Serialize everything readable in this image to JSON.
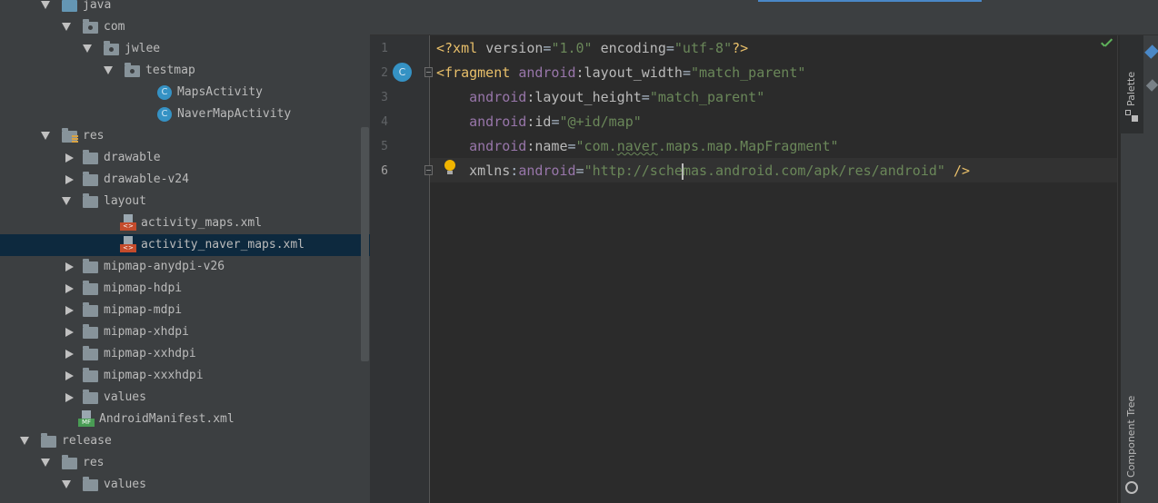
{
  "project_tree": {
    "items": [
      {
        "label": "java",
        "expanded": true,
        "icon": "folder-blue-icon"
      },
      {
        "label": "com",
        "expanded": true,
        "icon": "package-icon"
      },
      {
        "label": "jwlee",
        "expanded": true,
        "icon": "package-icon"
      },
      {
        "label": "testmap",
        "expanded": true,
        "icon": "package-icon"
      },
      {
        "label": "MapsActivity",
        "icon": "class-icon",
        "icon_text": "C"
      },
      {
        "label": "NaverMapActivity",
        "icon": "class-icon",
        "icon_text": "C"
      },
      {
        "label": "res",
        "expanded": true,
        "icon": "resource-folder-icon"
      },
      {
        "label": "drawable",
        "expanded": false,
        "icon": "folder-icon"
      },
      {
        "label": "drawable-v24",
        "expanded": false,
        "icon": "folder-icon"
      },
      {
        "label": "layout",
        "expanded": true,
        "icon": "folder-icon"
      },
      {
        "label": "activity_maps.xml",
        "icon": "xml-file-icon",
        "icon_text": "<>"
      },
      {
        "label": "activity_naver_maps.xml",
        "icon": "xml-file-icon",
        "icon_text": "<>",
        "selected": true
      },
      {
        "label": "mipmap-anydpi-v26",
        "expanded": false,
        "icon": "folder-icon"
      },
      {
        "label": "mipmap-hdpi",
        "expanded": false,
        "icon": "folder-icon"
      },
      {
        "label": "mipmap-mdpi",
        "expanded": false,
        "icon": "folder-icon"
      },
      {
        "label": "mipmap-xhdpi",
        "expanded": false,
        "icon": "folder-icon"
      },
      {
        "label": "mipmap-xxhdpi",
        "expanded": false,
        "icon": "folder-icon"
      },
      {
        "label": "mipmap-xxxhdpi",
        "expanded": false,
        "icon": "folder-icon"
      },
      {
        "label": "values",
        "expanded": false,
        "icon": "folder-icon"
      },
      {
        "label": "AndroidManifest.xml",
        "icon": "manifest-file-icon",
        "icon_text": "MF"
      },
      {
        "label": "release",
        "expanded": true,
        "icon": "folder-icon"
      },
      {
        "label": "res",
        "expanded": true,
        "icon": "folder-icon"
      },
      {
        "label": "values",
        "expanded": true,
        "icon": "folder-icon"
      }
    ]
  },
  "editor": {
    "line_numbers": [
      "1",
      "2",
      "3",
      "4",
      "5",
      "6"
    ],
    "current_line": 6,
    "gutter_class_badge": "C",
    "lines": [
      [
        {
          "t": "<?xml ",
          "c": "tag"
        },
        {
          "t": "version",
          "c": "attr"
        },
        {
          "t": "=",
          "c": "pl"
        },
        {
          "t": "\"1.0\"",
          "c": "str"
        },
        {
          "t": " encoding",
          "c": "attr"
        },
        {
          "t": "=",
          "c": "pl"
        },
        {
          "t": "\"utf-8\"",
          "c": "str"
        },
        {
          "t": "?>",
          "c": "tag"
        }
      ],
      [
        {
          "t": "<fragment ",
          "c": "tag"
        },
        {
          "t": "android",
          "c": "ns"
        },
        {
          "t": ":layout_width",
          "c": "attr"
        },
        {
          "t": "=",
          "c": "pl"
        },
        {
          "t": "\"match_parent\"",
          "c": "str"
        }
      ],
      [
        {
          "t": "    ",
          "c": "pl"
        },
        {
          "t": "android",
          "c": "ns"
        },
        {
          "t": ":layout_height",
          "c": "attr"
        },
        {
          "t": "=",
          "c": "pl"
        },
        {
          "t": "\"match_parent\"",
          "c": "str"
        }
      ],
      [
        {
          "t": "    ",
          "c": "pl"
        },
        {
          "t": "android",
          "c": "ns"
        },
        {
          "t": ":id",
          "c": "attr"
        },
        {
          "t": "=",
          "c": "pl"
        },
        {
          "t": "\"@+id/map\"",
          "c": "str"
        }
      ],
      [
        {
          "t": "    ",
          "c": "pl"
        },
        {
          "t": "android",
          "c": "ns"
        },
        {
          "t": ":name",
          "c": "attr"
        },
        {
          "t": "=",
          "c": "pl"
        },
        {
          "t": "\"com.",
          "c": "str"
        },
        {
          "t": "naver",
          "c": "str",
          "squiggle": true
        },
        {
          "t": ".maps.map.MapFragment\"",
          "c": "str"
        }
      ],
      [
        {
          "t": "    ",
          "c": "pl"
        },
        {
          "t": "xmlns",
          "c": "attr"
        },
        {
          "t": ":",
          "c": "pl"
        },
        {
          "t": "android",
          "c": "ns"
        },
        {
          "t": "=",
          "c": "pl"
        },
        {
          "t": "\"http://sche",
          "c": "str"
        },
        {
          "caret": true
        },
        {
          "t": "mas.android.com/apk/res/android\"",
          "c": "str"
        },
        {
          "t": " />",
          "c": "tag"
        }
      ]
    ]
  },
  "right_panel": {
    "palette_label": "Palette",
    "component_tree_label": "Component Tree"
  },
  "colors": {
    "tree_bg": "#3c3f41",
    "editor_bg": "#2b2b2b",
    "selection": "#0d293e",
    "tag": "#e8bf6a",
    "namespace": "#9876aa",
    "string": "#6a8759"
  }
}
